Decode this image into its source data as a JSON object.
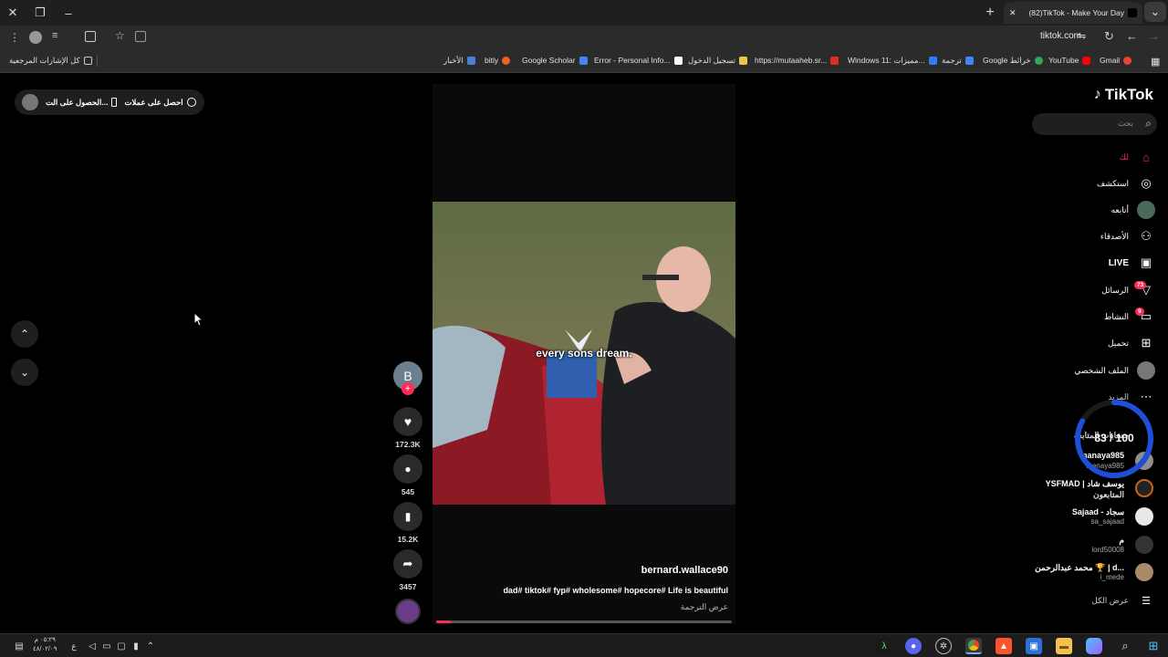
{
  "browser": {
    "tab_title": "(82)TikTok - Make Your Day",
    "url": "tiktok.com",
    "bookmarks": [
      {
        "label": "كل الإشارات المرجعية",
        "color": "#cfcfcf"
      },
      {
        "label": "الأخبار",
        "color": "#4a7fd8"
      },
      {
        "label": "bitly",
        "color": "#ee6123"
      },
      {
        "label": "Google Scholar",
        "color": "#4285f4"
      },
      {
        "label": "Error - Personal Info...",
        "color": "#ffffff"
      },
      {
        "label": "تسجيل الدخول",
        "color": "#e6c84a"
      },
      {
        "label": "https://mutaaheb.sr...",
        "color": "#d93025"
      },
      {
        "label": "Windows 11: مميزات...",
        "color": "#2d7ff9"
      },
      {
        "label": "ترجمة",
        "color": "#4285f4"
      },
      {
        "label": "Google خرائط",
        "color": "#34a853"
      },
      {
        "label": "YouTube",
        "color": "#ff0000"
      },
      {
        "label": "Gmail",
        "color": "#ea4335"
      }
    ]
  },
  "promo": {
    "get_coins": "احصل على عملات",
    "get_app": "الحصول على الت..."
  },
  "video": {
    "caption": "every sons dream.",
    "username": "bernard.wallace90",
    "description": "dad# tiktok# fyp# wholesome# hopecore# Life is beautiful",
    "translate": "عرض الترجمة",
    "progress_fraction": 0.05,
    "avatar_letter": "B"
  },
  "actions": {
    "likes": "172.3K",
    "comments": "545",
    "saves": "15.2K",
    "shares": "3457"
  },
  "sidebar": {
    "logo": "TikTok",
    "search_placeholder": "بحث",
    "nav": [
      {
        "label": "لك",
        "icon": "home-icon"
      },
      {
        "label": "استكشف",
        "icon": "compass-icon"
      },
      {
        "label": "أتابعه",
        "icon": "following-avatar-icon"
      },
      {
        "label": "الأصدقاء",
        "icon": "friends-icon"
      },
      {
        "label": "LIVE",
        "icon": "live-icon"
      },
      {
        "label": "الرسائل",
        "icon": "messages-icon",
        "badge": "73"
      },
      {
        "label": "النشاط",
        "icon": "activity-icon",
        "badge": "9"
      },
      {
        "label": "تحميل",
        "icon": "upload-icon"
      },
      {
        "label": "الملف الشخصي",
        "icon": "profile-icon"
      },
      {
        "label": "المزيد",
        "icon": "more-icon"
      }
    ],
    "following_header": "حسابات المتابعة",
    "following": [
      {
        "name": "manaya985",
        "handle": "manaya985",
        "color": "#8e8e8e"
      },
      {
        "name": "YSFMAD | يوسف شاد",
        "handle": "المتابعون",
        "color": "#c0651a"
      },
      {
        "name": "Sajaad - سجاد",
        "handle": "sa_sajaad",
        "color": "#e8e8e8"
      },
      {
        "name": "م",
        "handle": "lord50008",
        "color": "#333333"
      },
      {
        "name": "محمد عبدالرحمن 🏆 | d...",
        "handle": "i_mede",
        "color": "#a88a6a"
      }
    ],
    "see_all": "عرض الكل"
  },
  "overlay": {
    "score_text": "83 / 100",
    "score_fraction": 0.83
  },
  "taskbar": {
    "time": "٠٥:٢٩ م",
    "date": "٤٨/٠٢/٠٩",
    "lang": "ع"
  },
  "colors": {
    "accent": "#fe2c55",
    "overlay_ring": "#1f4fd8"
  }
}
